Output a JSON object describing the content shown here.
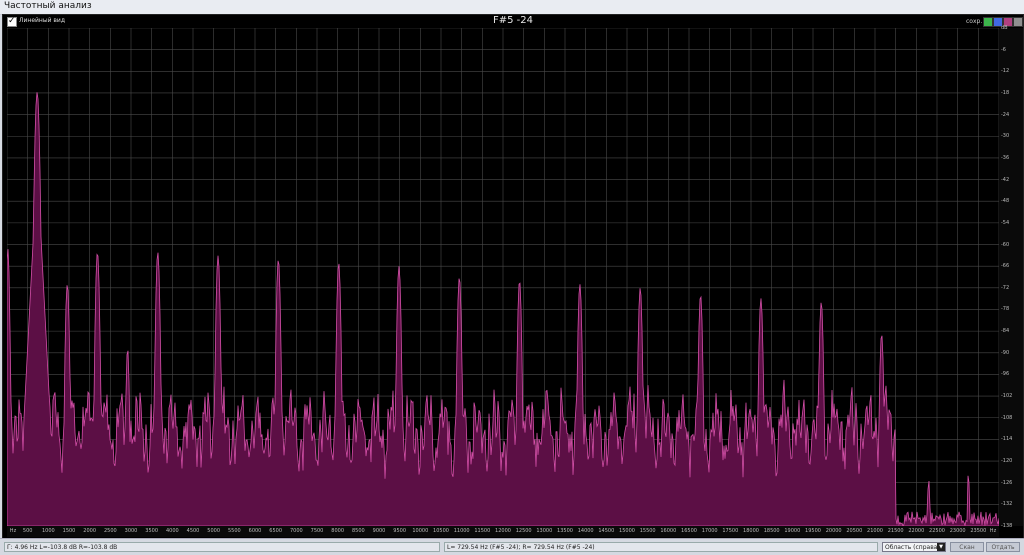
{
  "window": {
    "title": "Частотный анализ"
  },
  "header": {
    "checkbox_label": "Линейный вид",
    "checkbox_checked": true,
    "graph_title": "F#5 -24",
    "service_label": "сохр.",
    "window_buttons": [
      {
        "name": "green",
        "color": "#3cb44b"
      },
      {
        "name": "blue",
        "color": "#4169e1"
      },
      {
        "name": "magenta",
        "color": "#b04080"
      },
      {
        "name": "gray",
        "color": "#909090"
      }
    ]
  },
  "status": {
    "left": "Г: 4.96 Hz  L=-103.8 dB  R=-103.8 dB",
    "right": "L= 729.54 Hz (F#5 -24); R= 729.54 Hz (F#5 -24)",
    "select_value": "Область (справа о",
    "btn_scan": "Скан",
    "btn_close": "Отдать"
  },
  "colors": {
    "fill": "#5c0f45",
    "stroke": "#d44fa8",
    "grid": "#4a4a4a",
    "bg": "#000000"
  },
  "chart_data": {
    "type": "area",
    "title": "F#5 -24",
    "xlabel": "Hz",
    "ylabel": "dB",
    "xlim": [
      0,
      24000
    ],
    "ylim": [
      -140,
      0
    ],
    "grid": true,
    "x_ticks": [
      "Hz",
      "500",
      "1000",
      "1500",
      "2000",
      "2500",
      "3000",
      "3500",
      "4000",
      "4500",
      "5000",
      "5500",
      "6000",
      "6500",
      "7000",
      "7500",
      "8000",
      "8500",
      "9000",
      "9500",
      "10000",
      "10500",
      "11000",
      "11500",
      "12000",
      "12500",
      "13000",
      "13500",
      "14000",
      "14500",
      "15000",
      "15500",
      "16000",
      "16500",
      "17000",
      "17500",
      "18000",
      "18500",
      "19000",
      "19500",
      "20000",
      "20500",
      "21000",
      "21500",
      "22000",
      "22500",
      "23000",
      "23500",
      "Hz"
    ],
    "y_ticks": [
      "dB",
      "-6",
      "-12",
      "-18",
      "-24",
      "-30",
      "-36",
      "-42",
      "-48",
      "-54",
      "-60",
      "-66",
      "-72",
      "-78",
      "-84",
      "-90",
      "-96",
      "-102",
      "-108",
      "-114",
      "-120",
      "-126",
      "-132",
      "-138"
    ],
    "floor": -140,
    "peaks": [
      {
        "freq": 20,
        "level": -62,
        "width": 60
      },
      {
        "freq": 729.5,
        "level": -18,
        "width": 80
      },
      {
        "freq": 1459,
        "level": -72,
        "width": 70
      },
      {
        "freq": 2188,
        "level": -63,
        "width": 70
      },
      {
        "freq": 2918,
        "level": -90,
        "width": 60
      },
      {
        "freq": 3648,
        "level": -63,
        "width": 70
      },
      {
        "freq": 5106,
        "level": -64,
        "width": 70
      },
      {
        "freq": 6565,
        "level": -65,
        "width": 70
      },
      {
        "freq": 8025,
        "level": -66,
        "width": 70
      },
      {
        "freq": 9483,
        "level": -67,
        "width": 70
      },
      {
        "freq": 10944,
        "level": -70,
        "width": 70
      },
      {
        "freq": 12400,
        "level": -71,
        "width": 70
      },
      {
        "freq": 13860,
        "level": -72,
        "width": 70
      },
      {
        "freq": 15320,
        "level": -73,
        "width": 70
      },
      {
        "freq": 16780,
        "level": -75,
        "width": 70
      },
      {
        "freq": 18240,
        "level": -76,
        "width": 70
      },
      {
        "freq": 19700,
        "level": -77,
        "width": 70
      },
      {
        "freq": 21160,
        "level": -86,
        "width": 70
      },
      {
        "freq": 22300,
        "level": -127,
        "width": 60
      },
      {
        "freq": 23260,
        "level": -124,
        "width": 40
      }
    ]
  }
}
